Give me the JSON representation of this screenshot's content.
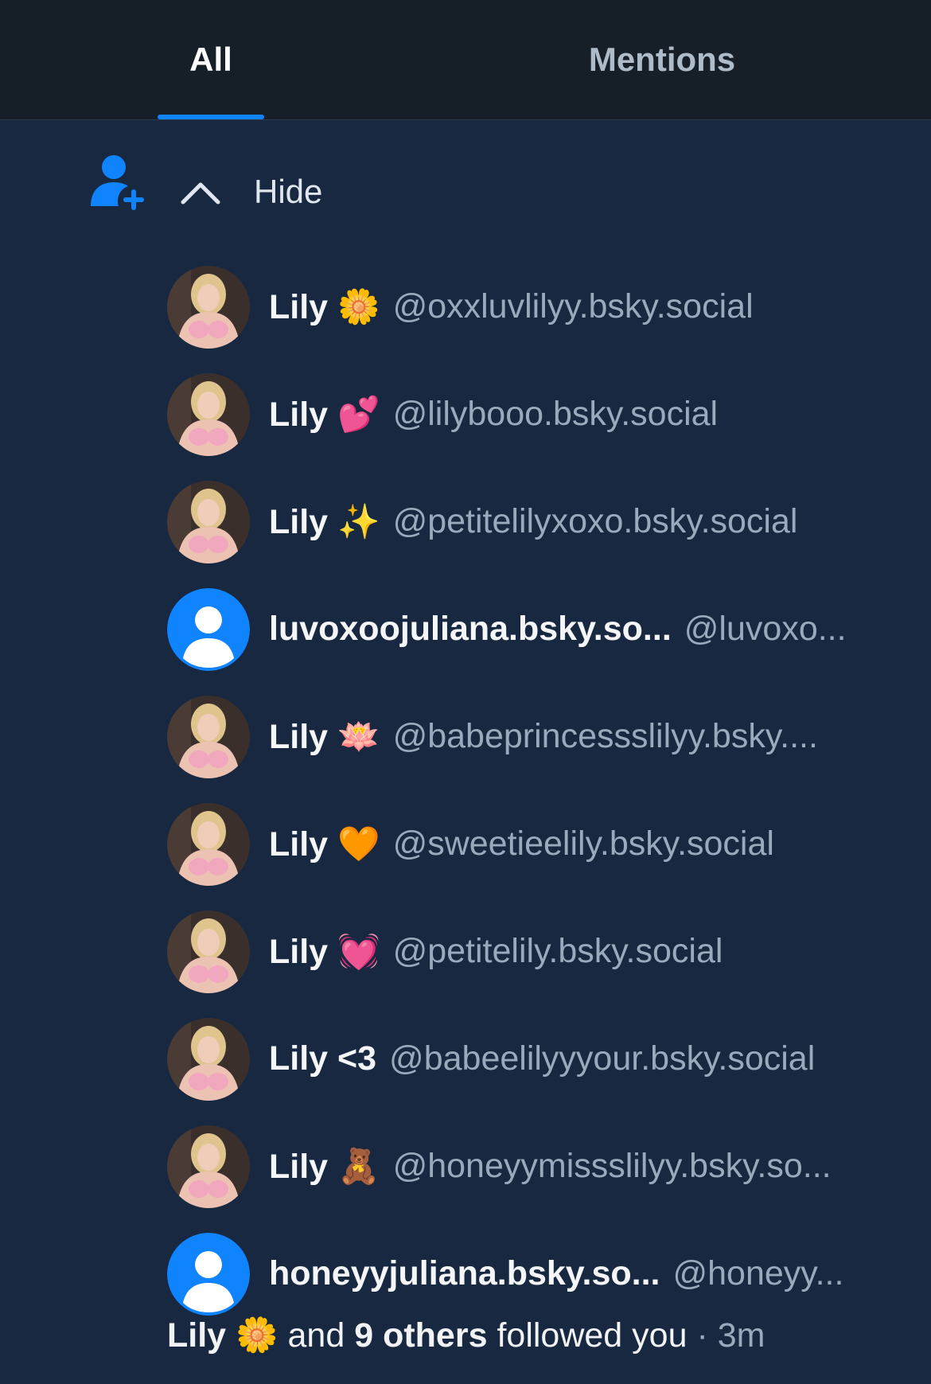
{
  "tabs": [
    {
      "label": "All",
      "selected": true
    },
    {
      "label": "Mentions",
      "selected": false
    }
  ],
  "accent_color": "#1083fe",
  "notification": {
    "icon": "person-plus-icon",
    "toggle_icon": "chevron-up-icon",
    "toggle_label": "Hide",
    "followers": [
      {
        "display_name": "Lily 🌼",
        "handle": "@oxxluvlilyy.bsky.social",
        "avatar": "photo"
      },
      {
        "display_name": "Lily 💕",
        "handle": "@lilybooo.bsky.social",
        "avatar": "photo"
      },
      {
        "display_name": "Lily ✨",
        "handle": "@petitelilyxoxo.bsky.social",
        "avatar": "photo"
      },
      {
        "display_name": "luvoxoojuliana.bsky.so...",
        "handle": "@luvoxo...",
        "avatar": "default"
      },
      {
        "display_name": "Lily 🪷",
        "handle": "@babeprincessslilyy.bsky....",
        "avatar": "photo"
      },
      {
        "display_name": "Lily 🧡",
        "handle": "@sweetieelily.bsky.social",
        "avatar": "photo"
      },
      {
        "display_name": "Lily 💓",
        "handle": "@petitelily.bsky.social",
        "avatar": "photo"
      },
      {
        "display_name": "Lily <3",
        "handle": "@babeelilyyyour.bsky.social",
        "avatar": "photo"
      },
      {
        "display_name": "Lily 🧸",
        "handle": "@honeyymissslilyy.bsky.so...",
        "avatar": "photo"
      },
      {
        "display_name": "honeyyjuliana.bsky.so...",
        "handle": "@honeyy...",
        "avatar": "default"
      }
    ],
    "summary": {
      "first_name": "Lily 🌼",
      "and_text": "and",
      "others": "9 others",
      "action": "followed you",
      "separator": "·",
      "time": "3m"
    }
  }
}
